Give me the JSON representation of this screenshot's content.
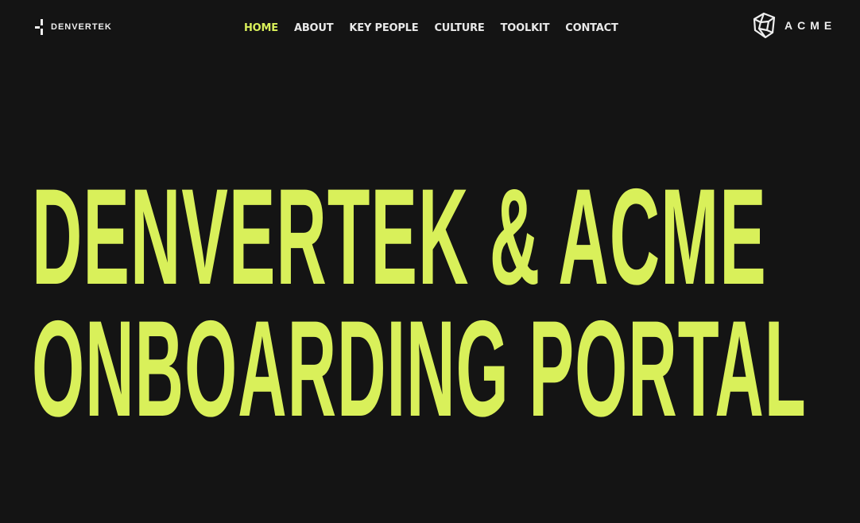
{
  "header": {
    "left_logo": {
      "text": "DENVERTEK",
      "icon": "cross-mark-icon"
    },
    "right_logo": {
      "text": "ACME",
      "icon": "wireframe-cube-icon"
    },
    "nav": [
      {
        "label": "HOME",
        "active": true
      },
      {
        "label": "ABOUT",
        "active": false
      },
      {
        "label": "KEY PEOPLE",
        "active": false
      },
      {
        "label": "CULTURE",
        "active": false
      },
      {
        "label": "TOOLKIT",
        "active": false
      },
      {
        "label": "CONTACT",
        "active": false
      }
    ]
  },
  "hero": {
    "line1": "DENVERTEK & ACME",
    "line2": "ONBOARDING PORTAL"
  },
  "colors": {
    "background": "#141414",
    "accent": "#d9f05a",
    "text": "#e8e8e8"
  }
}
